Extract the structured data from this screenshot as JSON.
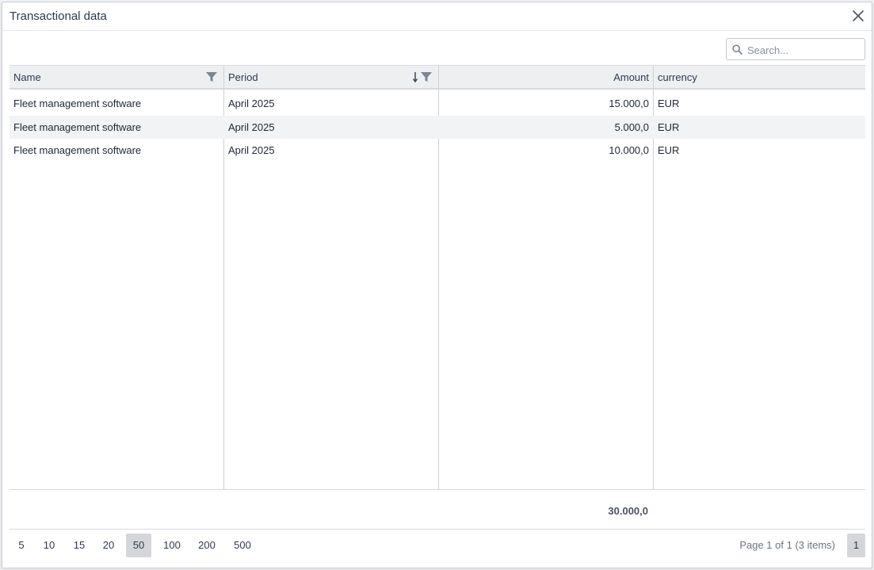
{
  "dialog": {
    "title": "Transactional data"
  },
  "search": {
    "placeholder": "Search...",
    "value": ""
  },
  "grid": {
    "columns": [
      {
        "label": "Name"
      },
      {
        "label": "Period"
      },
      {
        "label": "Amount"
      },
      {
        "label": "currency"
      }
    ],
    "rows": [
      {
        "name": "Fleet management software",
        "period": "April 2025",
        "amount": "15.000,0",
        "currency": "EUR"
      },
      {
        "name": "Fleet management software",
        "period": "April 2025",
        "amount": "5.000,0",
        "currency": "EUR"
      },
      {
        "name": "Fleet management software",
        "period": "April 2025",
        "amount": "10.000,0",
        "currency": "EUR"
      }
    ],
    "total_amount": "30.000,0"
  },
  "pager": {
    "sizes": [
      "5",
      "10",
      "15",
      "20",
      "50",
      "100",
      "200",
      "500"
    ],
    "active_size": "50",
    "info": "Page 1 of 1 (3 items)",
    "current_page": "1"
  },
  "colors": {
    "header_bg": "#eeeff1",
    "alt_row_bg": "#f2f3f4",
    "filter_icon": "#7b8593",
    "active_chip": "#d4d6d9"
  },
  "icons": {
    "close": "close-icon",
    "search": "search-icon",
    "filter": "filter-icon",
    "sort": "sort-descending-icon"
  }
}
